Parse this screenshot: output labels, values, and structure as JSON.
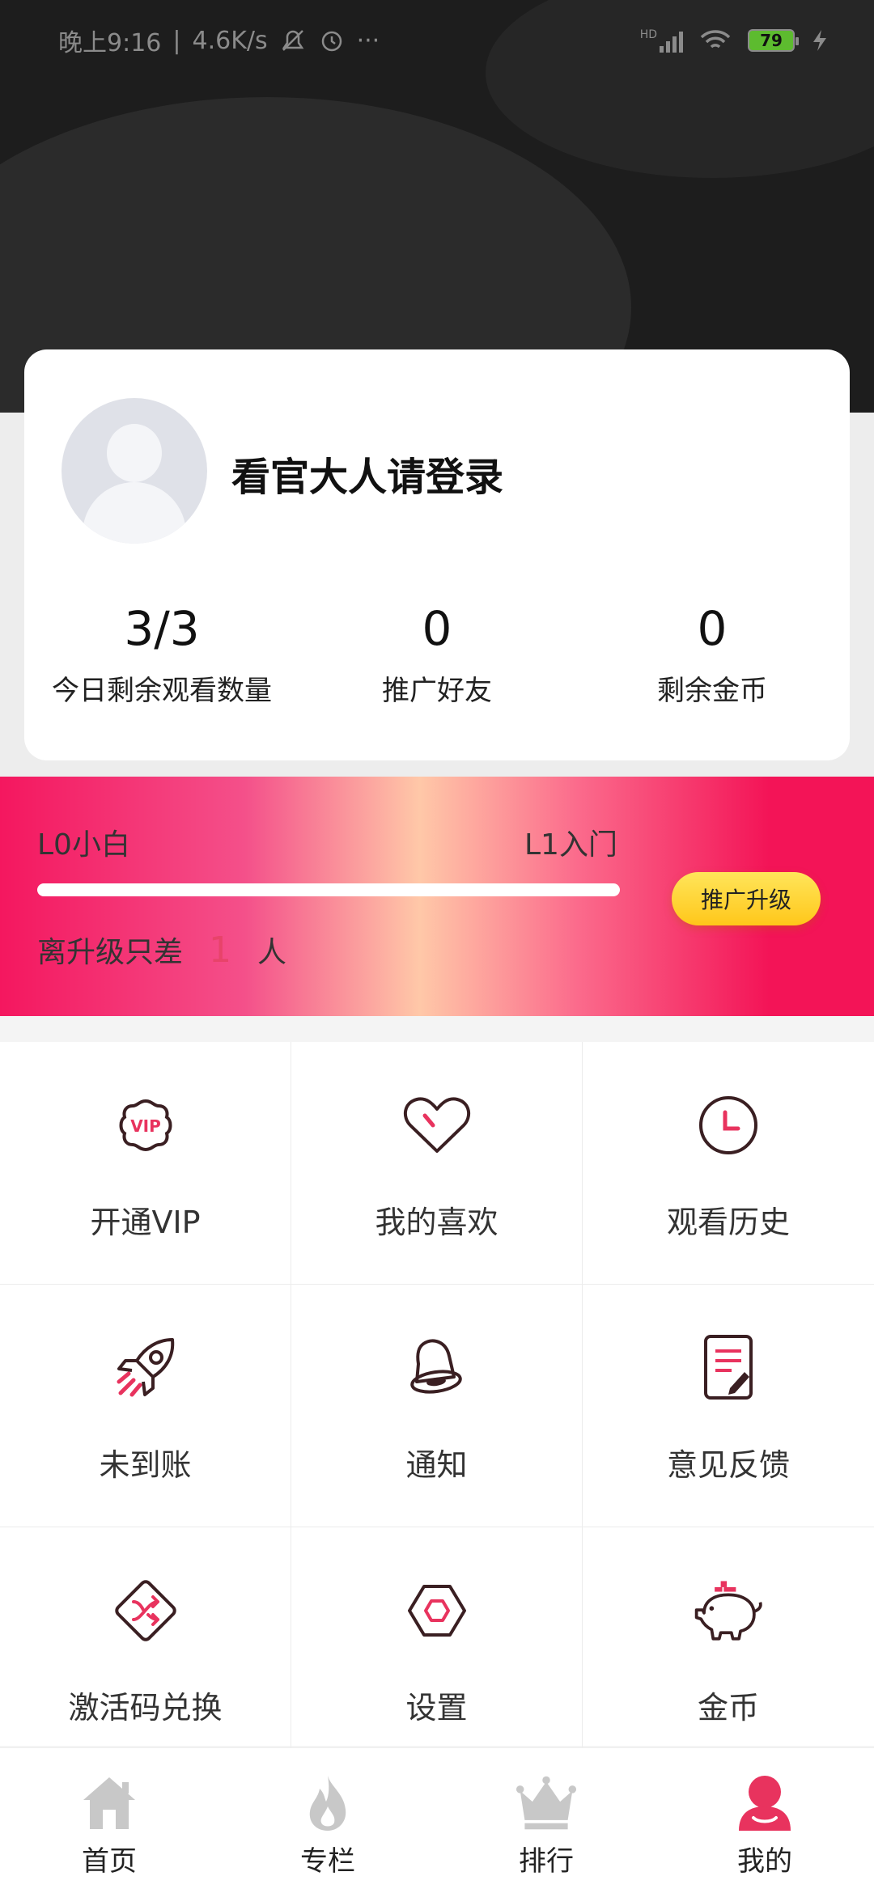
{
  "status_bar": {
    "time": "晚上9:16",
    "speed": "4.6K/s",
    "more": "···",
    "network": "HD",
    "battery": "79"
  },
  "profile": {
    "login_prompt": "看官大人请登录"
  },
  "stats": [
    {
      "value": "3/3",
      "label": "今日剩余观看数量"
    },
    {
      "value": "0",
      "label": "推广好友"
    },
    {
      "value": "0",
      "label": "剩余金币"
    }
  ],
  "level": {
    "current": "L0小白",
    "next": "L1入门",
    "progress_fraction": 1.0,
    "remaining_prefix": "离升级只差",
    "remaining_count": "1",
    "remaining_suffix": "人",
    "promote_button": "推广升级"
  },
  "menu": [
    {
      "label": "开通VIP",
      "icon": "vip-badge-icon"
    },
    {
      "label": "我的喜欢",
      "icon": "heart-icon"
    },
    {
      "label": "观看历史",
      "icon": "clock-icon"
    },
    {
      "label": "未到账",
      "icon": "rocket-icon"
    },
    {
      "label": "通知",
      "icon": "bell-icon"
    },
    {
      "label": "意见反馈",
      "icon": "feedback-note-icon"
    },
    {
      "label": "激活码兑换",
      "icon": "exchange-code-icon"
    },
    {
      "label": "设置",
      "icon": "settings-hexagon-icon"
    },
    {
      "label": "金币",
      "icon": "piggy-bank-icon"
    }
  ],
  "tabs": [
    {
      "label": "首页",
      "icon": "home-icon",
      "active": false
    },
    {
      "label": "专栏",
      "icon": "flame-icon",
      "active": false
    },
    {
      "label": "排行",
      "icon": "crown-icon",
      "active": false
    },
    {
      "label": "我的",
      "icon": "user-icon",
      "active": true
    }
  ],
  "colors": {
    "accent": "#e8335e",
    "banner_pink": "#f31457",
    "button_yellow": "#ffd23a",
    "icon_dark": "#3a1f22",
    "tab_inactive": "#c8c8c8"
  }
}
